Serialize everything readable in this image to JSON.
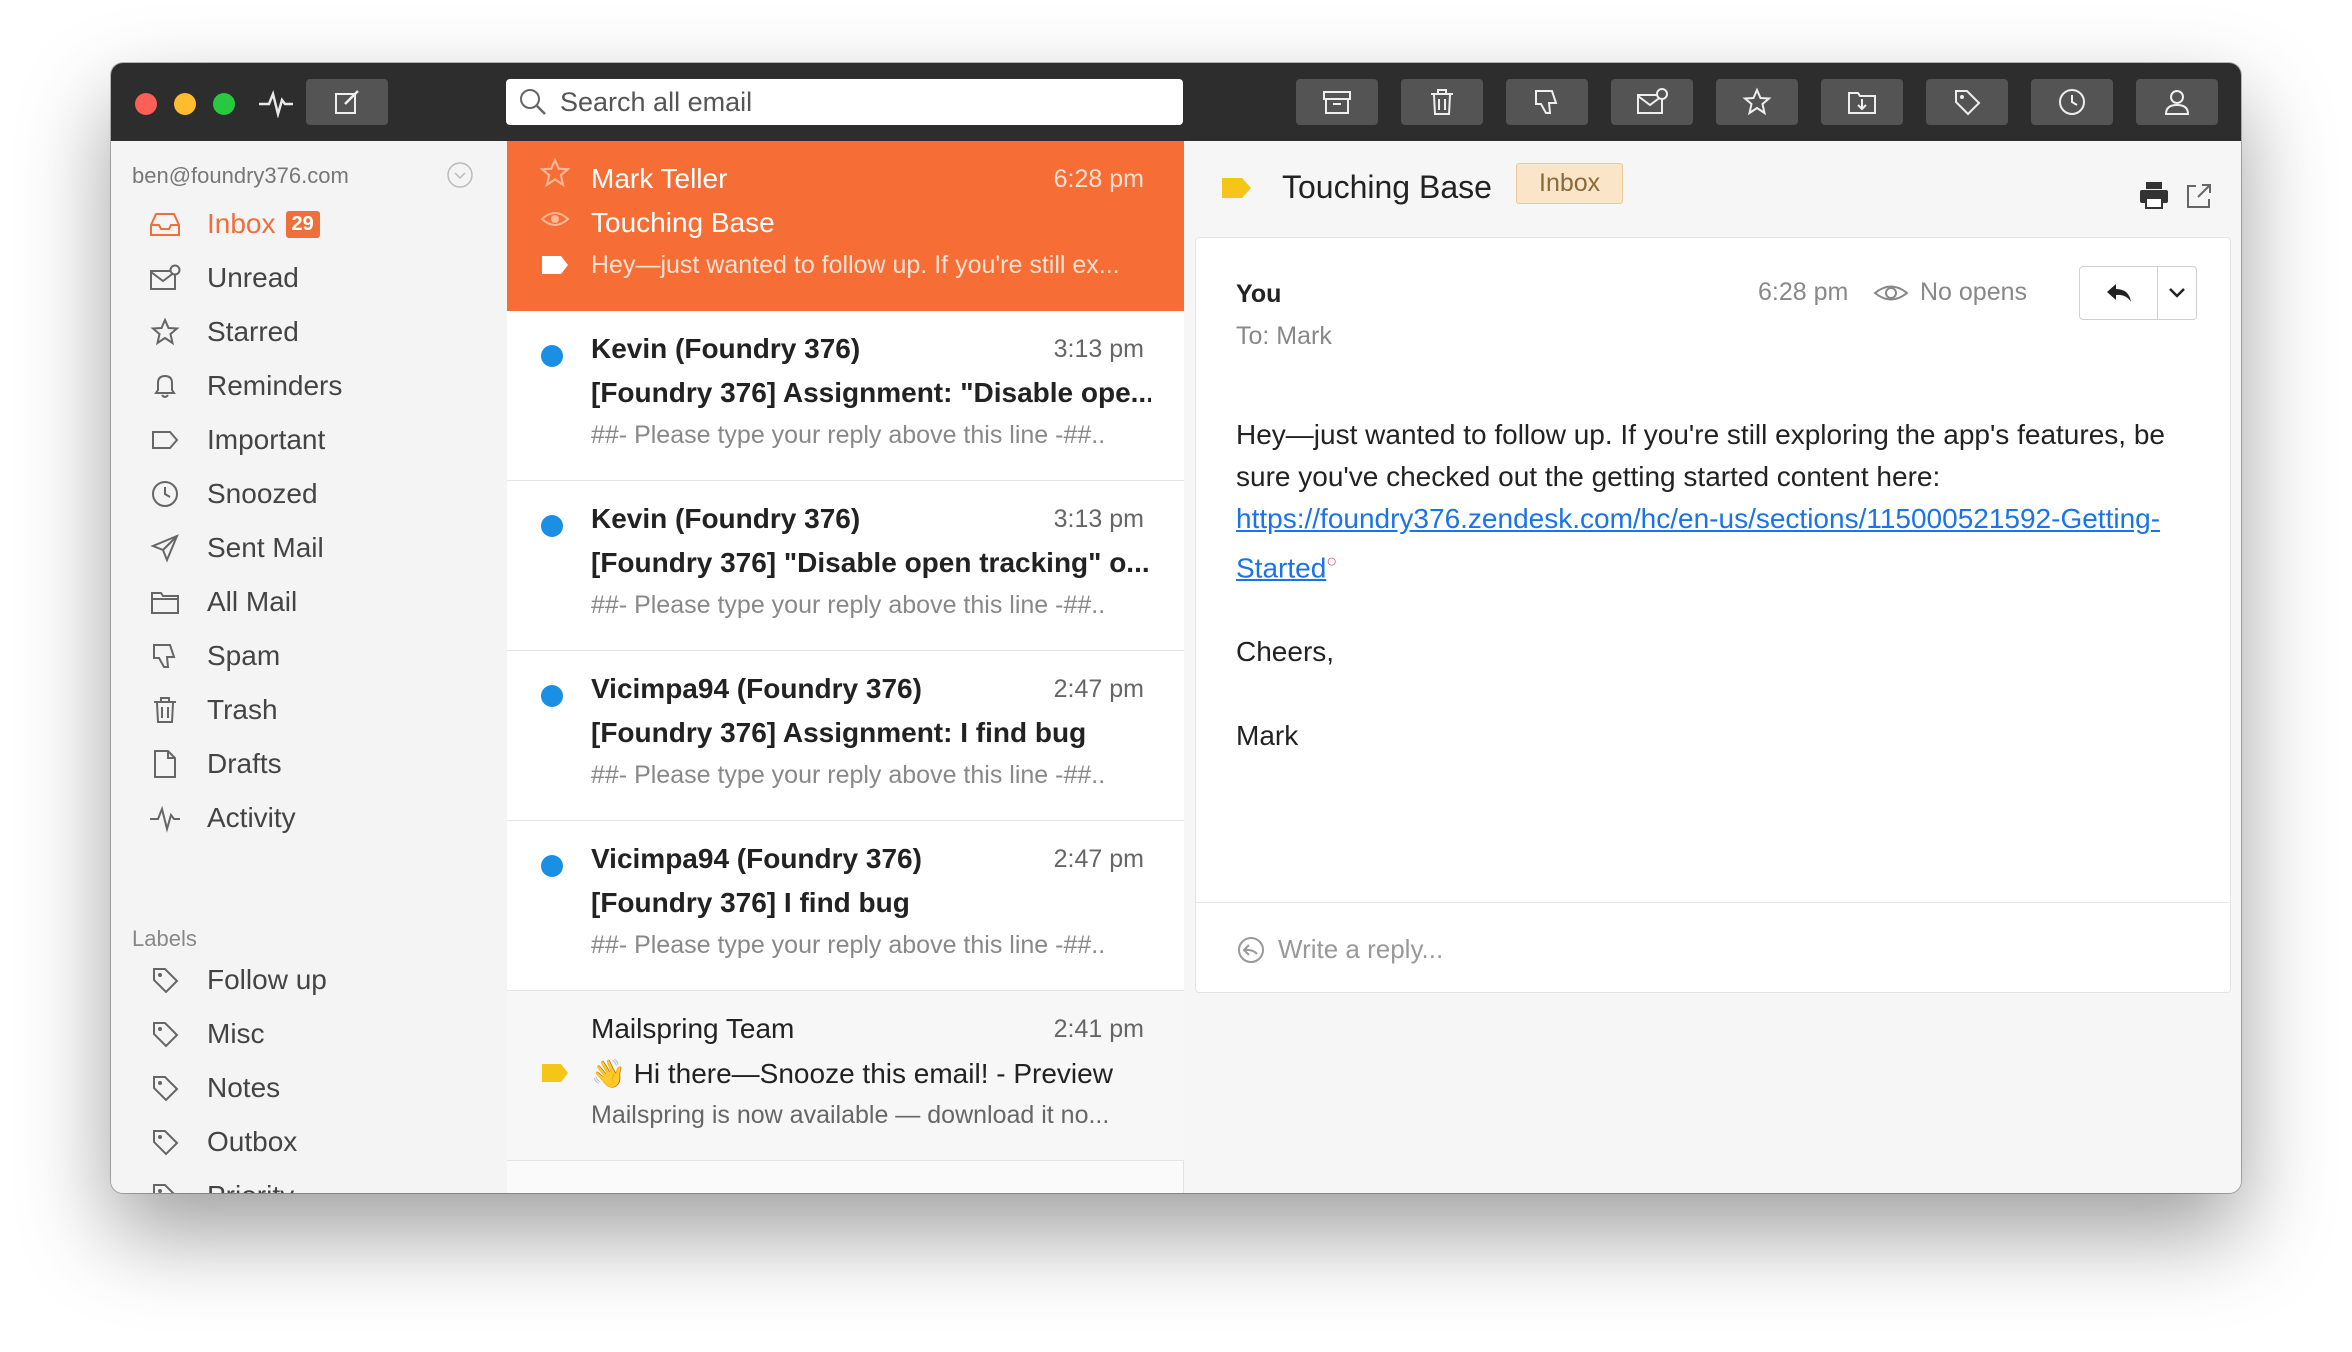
{
  "colors": {
    "accent": "#ef6f3a",
    "selected_row": "#f66d36",
    "unread_dot": "#1a8fe3",
    "toolbar_bg": "#2d2d2d",
    "toolbar_button": "#545454",
    "label_yellow": "#f5c518",
    "link": "#1a73e8"
  },
  "toolbar": {
    "search_placeholder": "Search all email",
    "left_icons": [
      "activity-icon",
      "compose-icon"
    ],
    "buttons": [
      "archive-icon",
      "trash-icon",
      "spam-icon",
      "mark-unread-icon",
      "star-icon",
      "move-to-folder-icon",
      "label-icon",
      "snooze-icon",
      "contact-icon"
    ]
  },
  "sidebar": {
    "account": "ben@foundry376.com",
    "items": [
      {
        "label": "Inbox",
        "icon": "inbox-icon",
        "badge": "29",
        "active": true
      },
      {
        "label": "Unread",
        "icon": "unread-icon"
      },
      {
        "label": "Starred",
        "icon": "star-icon"
      },
      {
        "label": "Reminders",
        "icon": "bell-icon"
      },
      {
        "label": "Important",
        "icon": "important-icon"
      },
      {
        "label": "Snoozed",
        "icon": "clock-icon"
      },
      {
        "label": "Sent Mail",
        "icon": "send-icon"
      },
      {
        "label": "All Mail",
        "icon": "folder-icon"
      },
      {
        "label": "Spam",
        "icon": "thumbs-down-icon"
      },
      {
        "label": "Trash",
        "icon": "trash-icon"
      },
      {
        "label": "Drafts",
        "icon": "draft-icon"
      },
      {
        "label": "Activity",
        "icon": "activity-icon"
      }
    ],
    "labels_heading": "Labels",
    "labels": [
      {
        "label": "Follow up",
        "icon": "tag-icon"
      },
      {
        "label": "Misc",
        "icon": "tag-icon"
      },
      {
        "label": "Notes",
        "icon": "tag-icon"
      },
      {
        "label": "Outbox",
        "icon": "tag-icon"
      },
      {
        "label": "Priority",
        "icon": "tag-icon"
      }
    ]
  },
  "messages": [
    {
      "from": "Mark Teller",
      "time": "6:28 pm",
      "subject": "Touching Base",
      "preview": "Hey—just wanted to follow up. If you're still ex...",
      "selected": true
    },
    {
      "from": "Kevin (Foundry 376)",
      "time": "3:13 pm",
      "subject": "[Foundry 376] Assignment: \"Disable ope...",
      "preview": "##- Please type your reply above this line -##..",
      "unread": true
    },
    {
      "from": "Kevin (Foundry 376)",
      "time": "3:13 pm",
      "subject": "[Foundry 376] \"Disable open tracking\" o...",
      "preview": "##- Please type your reply above this line -##..",
      "unread": true
    },
    {
      "from": "Vicimpa94 (Foundry 376)",
      "time": "2:47 pm",
      "subject": "[Foundry 376] Assignment: I find bug",
      "preview": "##- Please type your reply above this line -##..",
      "unread": true
    },
    {
      "from": "Vicimpa94 (Foundry 376)",
      "time": "2:47 pm",
      "subject": "[Foundry 376] I find bug",
      "preview": "##- Please type your reply above this line -##..",
      "unread": true
    },
    {
      "from": "Mailspring Team",
      "time": "2:41 pm",
      "subject": "👋 Hi there—Snooze this email! - Preview",
      "preview": "Mailspring is now available — download it no...",
      "label": "label-tag-icon"
    }
  ],
  "reader": {
    "subject": "Touching Base",
    "folder_chip": "Inbox",
    "from": "You",
    "to": "To: Mark",
    "time": "6:28 pm",
    "opens": "No opens",
    "body_line1": "Hey—just wanted to follow up. If you're still exploring the app's features, be sure you've checked out the getting started content here: ",
    "link_text": "https://foundry376.zendesk.com/hc/en-us/sections/115000521592-Getting-Started",
    "cheers": "Cheers,",
    "signature": "Mark",
    "reply_placeholder": "Write a reply..."
  }
}
